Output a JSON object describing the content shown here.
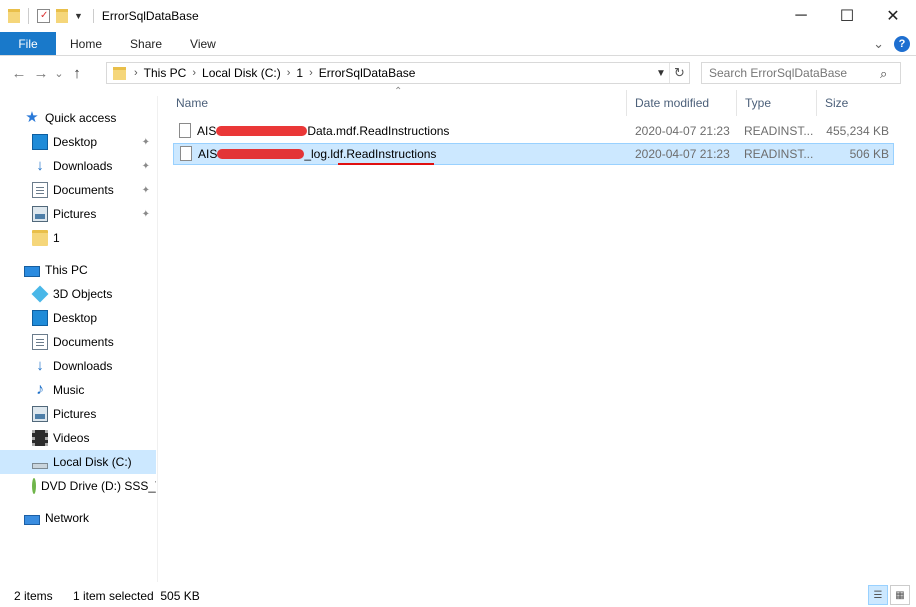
{
  "window": {
    "title": "ErrorSqlDataBase"
  },
  "window_controls": {
    "minimize": "─",
    "maximize": "☐",
    "close": "✕"
  },
  "ribbon": {
    "tabs": [
      "File",
      "Home",
      "Share",
      "View"
    ],
    "expand": "⌄",
    "help": "?"
  },
  "nav": {
    "back": "←",
    "forward": "→",
    "recent": "⌄",
    "up": "↑"
  },
  "address": {
    "crumbs": [
      "This PC",
      "Local Disk (C:)",
      "1",
      "ErrorSqlDataBase"
    ],
    "separator": "›"
  },
  "search": {
    "placeholder": "Search ErrorSqlDataBase"
  },
  "navpane": {
    "quick_access": "Quick access",
    "qa_items": [
      "Desktop",
      "Downloads",
      "Documents",
      "Pictures",
      "1"
    ],
    "this_pc": "This PC",
    "pc_items": [
      "3D Objects",
      "Desktop",
      "Documents",
      "Downloads",
      "Music",
      "Pictures",
      "Videos",
      "Local Disk (C:)",
      "DVD Drive (D:) SSS_)"
    ],
    "network": "Network",
    "pin_glyph": "📌"
  },
  "columns": {
    "name": "Name",
    "date": "Date modified",
    "type": "Type",
    "size": "Size",
    "sort_glyph": "⌃"
  },
  "files": [
    {
      "name_start": "AIS",
      "name_end": "Data.mdf.ReadInstructions",
      "date": "2020-04-07 21:23",
      "type": "READINST...",
      "size": "455,234 KB"
    },
    {
      "name_start": "AIS",
      "name_end": "_log.ldf.ReadInstructions",
      "date": "2020-04-07 21:23",
      "type": "READINST...",
      "size": "506 KB"
    }
  ],
  "status": {
    "items": "2 items",
    "selected": "1 item selected  505 KB"
  },
  "colors": {
    "accent": "#1979ca",
    "selection": "#cce8ff",
    "annotation": "#e01010"
  }
}
